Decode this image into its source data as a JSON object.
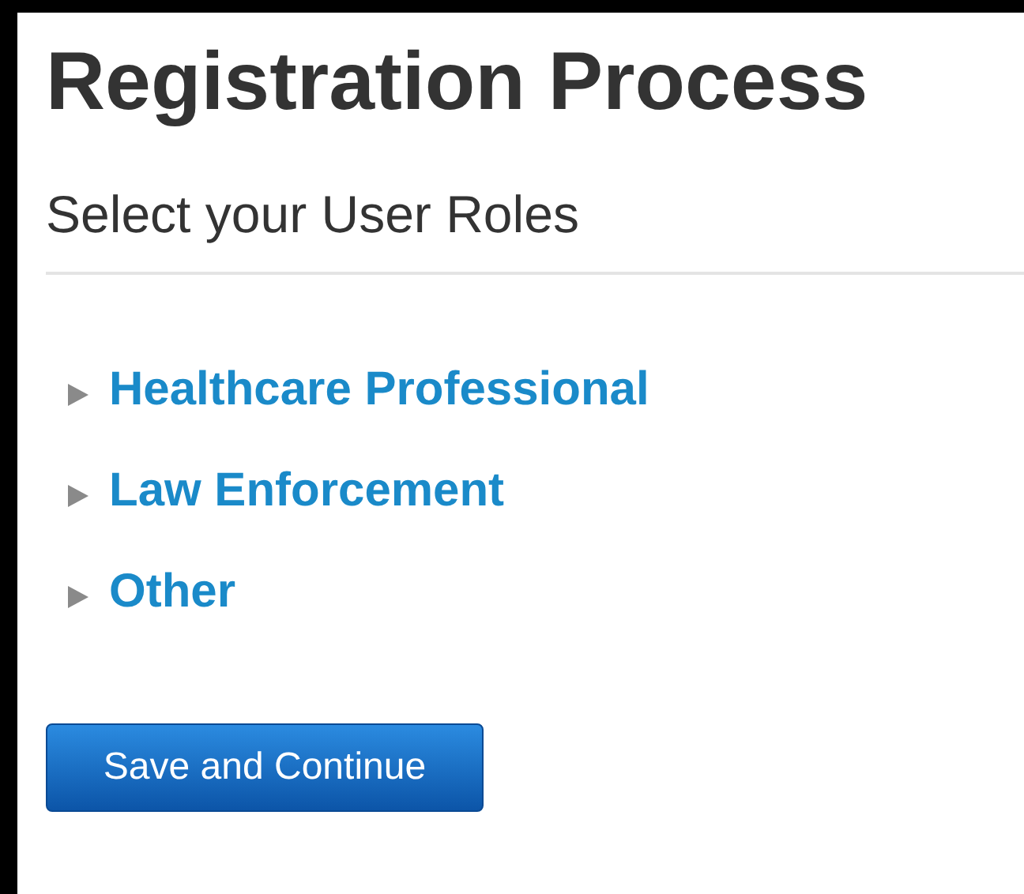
{
  "title": "Registration Process",
  "subtitle": "Select your User Roles",
  "roles": [
    {
      "label": "Healthcare Professional",
      "expanded": false
    },
    {
      "label": "Law Enforcement",
      "expanded": false
    },
    {
      "label": "Other",
      "expanded": false
    }
  ],
  "button": "Save and Continue"
}
